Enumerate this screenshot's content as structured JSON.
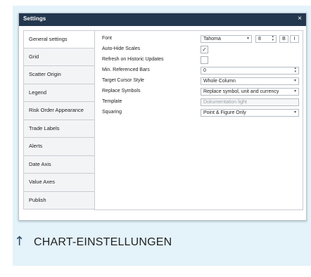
{
  "dialog": {
    "title": "Settings",
    "close_glyph": "×"
  },
  "nav": {
    "items": [
      {
        "label": "General settings",
        "active": true
      },
      {
        "label": "Grid"
      },
      {
        "label": "Scatter Origin"
      },
      {
        "label": "Legend"
      },
      {
        "label": "Risk Order Appearance"
      },
      {
        "label": "Trade Labels"
      },
      {
        "label": "Alerts"
      },
      {
        "label": "Date Axis"
      },
      {
        "label": "Value Axes"
      },
      {
        "label": "Publish"
      }
    ]
  },
  "settings": {
    "font": {
      "label": "Font",
      "value": "Tahoma",
      "size": "8",
      "bold": "B",
      "italic": "I"
    },
    "auto_hide": {
      "label": "Auto-Hide Scales",
      "checked": "✓"
    },
    "refresh": {
      "label": "Refresh on Historic Updates",
      "checked": ""
    },
    "min_bars": {
      "label": "Min. Referenced Bars",
      "value": "0"
    },
    "cursor": {
      "label": "Target Cursor Style",
      "value": "Whole Column"
    },
    "replace": {
      "label": "Replace Symbols",
      "value": "Replace symbol, unit and currency"
    },
    "template": {
      "label": "Template",
      "value": "Dokumentation light"
    },
    "squaring": {
      "label": "Squaring",
      "value": "Point & Figure Only"
    }
  },
  "footer": {
    "icon": "up-arrow-icon",
    "arrow_glyph": "↑",
    "text": "CHART-EINSTELLUNGEN"
  },
  "glyphs": {
    "dropdown": "▾",
    "spin": "▴▾"
  },
  "colors": {
    "titlebar": "#23374e",
    "background": "#e4f2fa"
  }
}
